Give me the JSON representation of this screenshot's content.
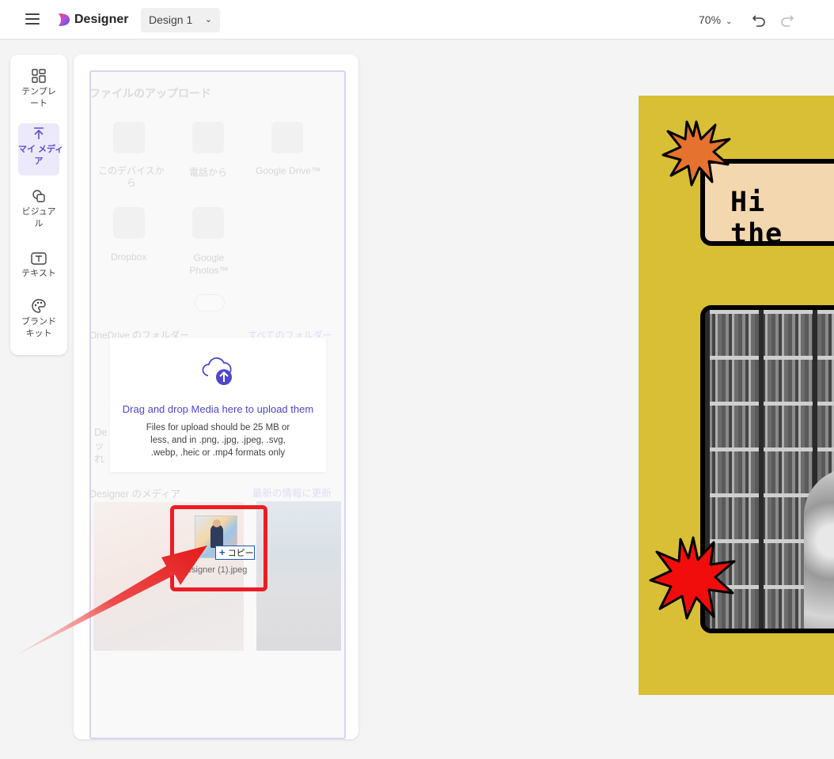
{
  "topbar": {
    "brand": "Designer",
    "design_name": "Design 1",
    "zoom": "70%"
  },
  "rail": {
    "items": [
      {
        "label": "テンプレ\nート",
        "icon": "template-icon"
      },
      {
        "label": "マイ メディ\nア",
        "icon": "upload-icon",
        "active": true
      },
      {
        "label": "ビジュア\nル",
        "icon": "visual-icon"
      },
      {
        "label": "テキスト",
        "icon": "text-icon"
      },
      {
        "label": "ブランド\nキット",
        "icon": "palette-icon"
      }
    ]
  },
  "panel": {
    "title": "ファイルのアップロード",
    "sources": [
      "このデバイスか\nら",
      "電話から",
      "Google Drive™",
      "Dropbox",
      "Google\nPhotos™"
    ],
    "onedrive_label": "OneDrive のフォルダー",
    "all_folders": "すべてのフォルダー",
    "designer_media": "Designer のメディア",
    "refresh": "最新の情報に更新",
    "partial_text": "De\nッ\nれ",
    "drop": {
      "title": "Drag and drop Media here to upload them",
      "subtitle": "Files for upload should be 25 MB or less, and in .png, .jpg, .jpeg, .svg, .webp, .heic or .mp4 formats only"
    },
    "dragged_file": {
      "name": "Designer (1).jpeg",
      "copy_label": "コピー"
    }
  },
  "canvas": {
    "greeting": "Hi the",
    "background_color": "#d9bf35"
  },
  "colors": {
    "accent": "#5b4fd3",
    "highlight": "#ec1c24"
  }
}
